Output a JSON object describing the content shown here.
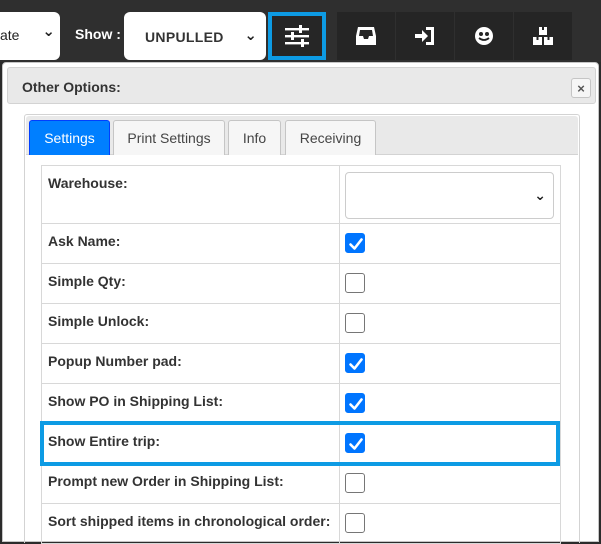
{
  "toolbar": {
    "date_select_value": "ate",
    "show_label": "Show :",
    "show_select_value": "UNPULLED",
    "buttons": [
      {
        "icon": "sliders-icon",
        "active": true
      },
      {
        "icon": "inbox-tray-icon",
        "active": false
      },
      {
        "icon": "sign-in-icon",
        "active": false
      },
      {
        "icon": "smiley-icon",
        "active": false
      },
      {
        "icon": "boxes-icon",
        "active": false
      }
    ]
  },
  "panel": {
    "title": "Other Options:",
    "close_symbol": "×",
    "tabs": [
      {
        "label": "Settings",
        "active": true
      },
      {
        "label": "Print Settings",
        "active": false
      },
      {
        "label": "Info",
        "active": false
      },
      {
        "label": "Receiving",
        "active": false
      }
    ]
  },
  "settings": {
    "warehouse_label": "Warehouse:",
    "warehouse_value": "",
    "rows": [
      {
        "label": "Ask Name:",
        "checked": true
      },
      {
        "label": "Simple Qty:",
        "checked": false
      },
      {
        "label": "Simple Unlock:",
        "checked": false
      },
      {
        "label": "Popup Number pad:",
        "checked": true
      },
      {
        "label": "Show PO in Shipping List:",
        "checked": true
      },
      {
        "label": "Show Entire trip:",
        "checked": true
      },
      {
        "label": "Prompt new Order in Shipping List:",
        "checked": false
      },
      {
        "label": "Sort shipped items in chronological order:",
        "checked": false
      }
    ]
  },
  "colors": {
    "accent_highlight": "#0d9be4",
    "tab_active": "#007fff",
    "checkbox_checked": "#0075ff"
  }
}
